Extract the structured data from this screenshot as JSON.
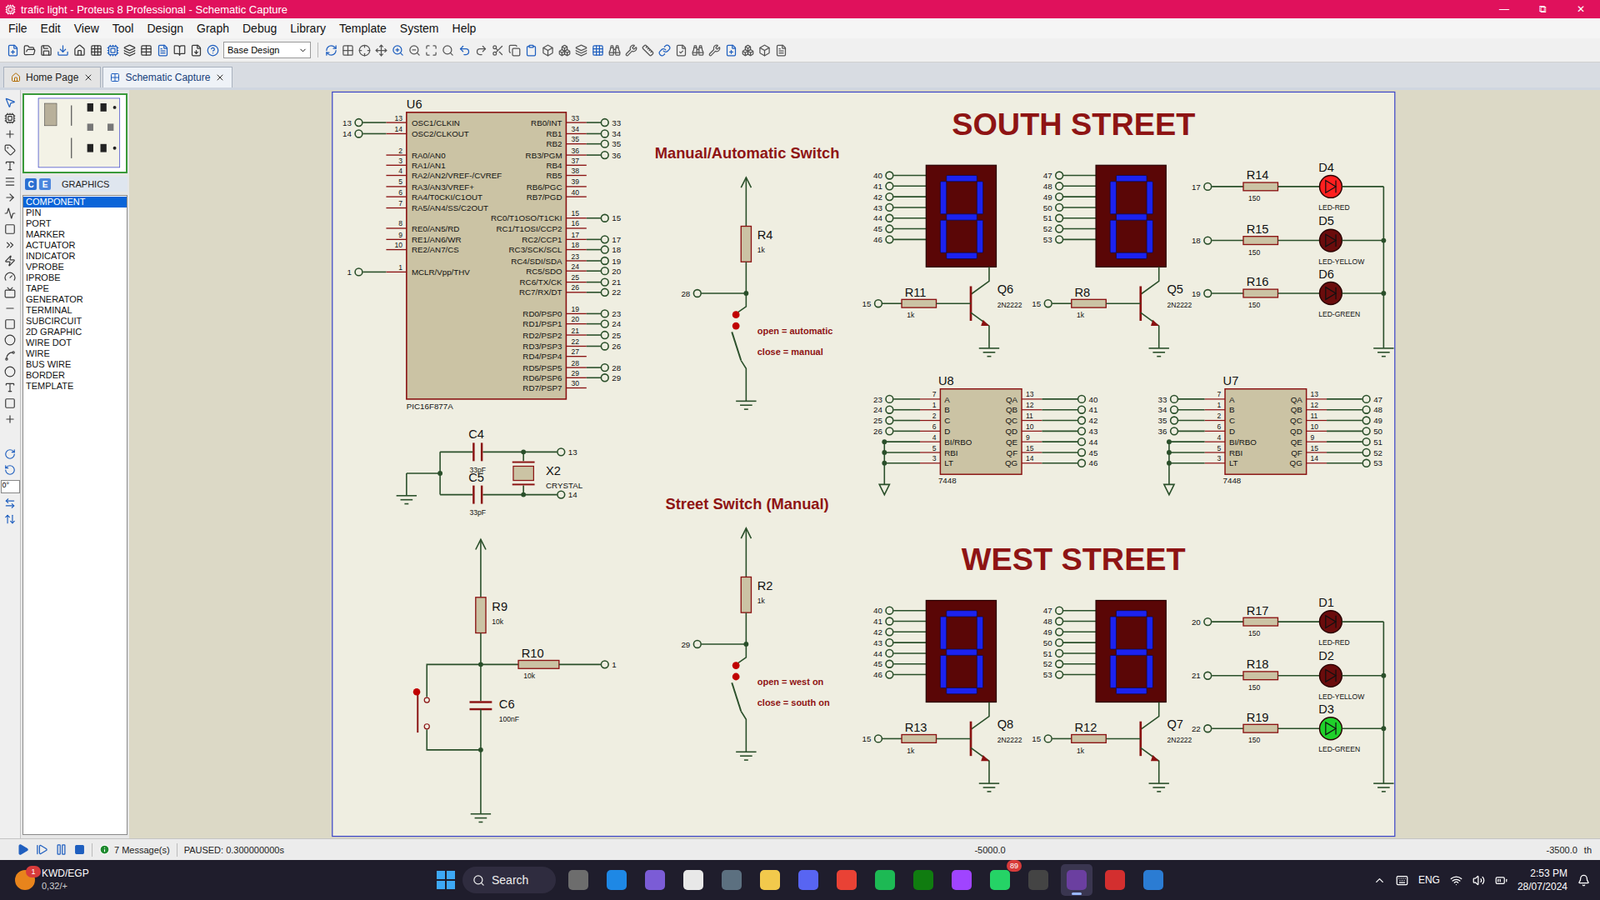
{
  "window": {
    "title": "trafic light - Proteus 8 Professional - Schematic Capture",
    "controls": [
      "—",
      "⧉",
      "✕"
    ]
  },
  "menu": [
    "File",
    "Edit",
    "View",
    "Tool",
    "Design",
    "Graph",
    "Debug",
    "Library",
    "Template",
    "System",
    "Help"
  ],
  "toolbar": {
    "design": "Base Design"
  },
  "tabs": [
    {
      "label": "Home Page",
      "selected": false
    },
    {
      "label": "Schematic Capture",
      "selected": true
    }
  ],
  "side_panel": {
    "mode_buttons": [
      {
        "label": "C",
        "selected": true
      },
      {
        "label": "E",
        "selected": false
      }
    ],
    "title": "GRAPHICS",
    "rotation": "0°",
    "items": [
      {
        "label": "COMPONENT",
        "selected": true
      },
      {
        "label": "PIN",
        "selected": false
      },
      {
        "label": "PORT",
        "selected": false
      },
      {
        "label": "MARKER",
        "selected": false
      },
      {
        "label": "ACTUATOR",
        "selected": false
      },
      {
        "label": "INDICATOR",
        "selected": false
      },
      {
        "label": "VPROBE",
        "selected": false
      },
      {
        "label": "IPROBE",
        "selected": false
      },
      {
        "label": "TAPE",
        "selected": false
      },
      {
        "label": "GENERATOR",
        "selected": false
      },
      {
        "label": "TERMINAL",
        "selected": false
      },
      {
        "label": "SUBCIRCUIT",
        "selected": false
      },
      {
        "label": "2D GRAPHIC",
        "selected": false
      },
      {
        "label": "WIRE DOT",
        "selected": false
      },
      {
        "label": "WIRE",
        "selected": false
      },
      {
        "label": "BUS WIRE",
        "selected": false
      },
      {
        "label": "BORDER",
        "selected": false
      },
      {
        "label": "TEMPLATE",
        "selected": false
      }
    ]
  },
  "schematic": {
    "mcu": {
      "ref": "U6",
      "part": "PIC16F877A",
      "left_pins": [
        {
          "pin": "13",
          "name": "OSC1/CLKIN",
          "net": "13"
        },
        {
          "pin": "14",
          "name": "OSC2/CLKOUT",
          "net": "14"
        },
        {
          "pin": "2",
          "name": "RA0/AN0",
          "net": ""
        },
        {
          "pin": "3",
          "name": "RA1/AN1",
          "net": ""
        },
        {
          "pin": "4",
          "name": "RA2/AN2/VREF-/CVREF",
          "net": ""
        },
        {
          "pin": "5",
          "name": "RA3/AN3/VREF+",
          "net": ""
        },
        {
          "pin": "6",
          "name": "RA4/T0CKI/C1OUT",
          "net": ""
        },
        {
          "pin": "7",
          "name": "RA5/AN4/SS/C2OUT",
          "net": ""
        },
        {
          "pin": "8",
          "name": "RE0/AN5/RD",
          "net": ""
        },
        {
          "pin": "9",
          "name": "RE1/AN6/WR",
          "net": ""
        },
        {
          "pin": "10",
          "name": "RE2/AN7/CS",
          "net": ""
        },
        {
          "pin": "1",
          "name": "MCLR/Vpp/THV",
          "net": "1"
        }
      ],
      "right_pins": [
        {
          "pin": "33",
          "name": "RB0/INT",
          "net": "33"
        },
        {
          "pin": "34",
          "name": "RB1",
          "net": "34"
        },
        {
          "pin": "35",
          "name": "RB2",
          "net": "35"
        },
        {
          "pin": "36",
          "name": "RB3/PGM",
          "net": "36"
        },
        {
          "pin": "37",
          "name": "RB4",
          "net": ""
        },
        {
          "pin": "38",
          "name": "RB5",
          "net": ""
        },
        {
          "pin": "39",
          "name": "RB6/PGC",
          "net": ""
        },
        {
          "pin": "40",
          "name": "RB7/PGD",
          "net": ""
        },
        {
          "pin": "15",
          "name": "RC0/T1OSO/T1CKI",
          "net": "15"
        },
        {
          "pin": "16",
          "name": "RC1/T1OSI/CCP2",
          "net": ""
        },
        {
          "pin": "17",
          "name": "RC2/CCP1",
          "net": "17"
        },
        {
          "pin": "18",
          "name": "RC3/SCK/SCL",
          "net": "18"
        },
        {
          "pin": "23",
          "name": "RC4/SDI/SDA",
          "net": "19"
        },
        {
          "pin": "24",
          "name": "RC5/SDO",
          "net": "20"
        },
        {
          "pin": "25",
          "name": "RC6/TX/CK",
          "net": "21"
        },
        {
          "pin": "26",
          "name": "RC7/RX/DT",
          "net": "22"
        },
        {
          "pin": "19",
          "name": "RD0/PSP0",
          "net": "23"
        },
        {
          "pin": "20",
          "name": "RD1/PSP1",
          "net": "24"
        },
        {
          "pin": "21",
          "name": "RD2/PSP2",
          "net": "25"
        },
        {
          "pin": "22",
          "name": "RD3/PSP3",
          "net": "26"
        },
        {
          "pin": "27",
          "name": "RD4/PSP4",
          "net": ""
        },
        {
          "pin": "28",
          "name": "RD5/PSP5",
          "net": "28"
        },
        {
          "pin": "29",
          "name": "RD6/PSP6",
          "net": "29"
        },
        {
          "pin": "30",
          "name": "RD7/PSP7",
          "net": ""
        }
      ]
    },
    "oscillator": {
      "caps": [
        {
          "ref": "C4",
          "value": "33pF"
        },
        {
          "ref": "C5",
          "value": "33pF"
        }
      ],
      "crystal": {
        "ref": "X2",
        "part": "CRYSTAL"
      },
      "nets": [
        "13",
        "14"
      ]
    },
    "reset": {
      "pullup": {
        "ref": "R9",
        "value": "10k"
      },
      "series": {
        "ref": "R10",
        "value": "10k"
      },
      "cap": {
        "ref": "C6",
        "value": "100nF"
      },
      "net": "1",
      "pressed": false
    },
    "switches": [
      {
        "title": "Manual/Automatic Switch",
        "resistor": {
          "ref": "R4",
          "value": "1k"
        },
        "net": "28",
        "open_label": "open = automatic",
        "close_label": "close = manual",
        "closed": false
      },
      {
        "title": "Street Switch (Manual)",
        "resistor": {
          "ref": "R2",
          "value": "1k"
        },
        "net": "29",
        "open_label": "open = west on",
        "close_label": "close = south on",
        "closed": false
      }
    ],
    "streets": [
      {
        "title": "SOUTH STREET",
        "displays": [
          {
            "pins": [
              "40",
              "41",
              "42",
              "43",
              "44",
              "45",
              "46"
            ],
            "segments": [
              true,
              true,
              true,
              true,
              true,
              true,
              true
            ],
            "transistor": {
              "ref": "Q6",
              "part": "2N2222"
            },
            "resistor": {
              "ref": "R11",
              "value": "1k",
              "net": "15"
            }
          },
          {
            "pins": [
              "47",
              "48",
              "49",
              "50",
              "51",
              "52",
              "53"
            ],
            "segments": [
              true,
              true,
              true,
              true,
              true,
              true,
              true
            ],
            "transistor": {
              "ref": "Q5",
              "part": "2N2222"
            },
            "resistor": {
              "ref": "R8",
              "value": "1k",
              "net": "15"
            }
          }
        ],
        "lights": [
          {
            "resistor": {
              "ref": "R14",
              "value": "150"
            },
            "net": "17",
            "ref": "D4",
            "part": "LED-RED",
            "on": true,
            "color": "#ff1f1f"
          },
          {
            "resistor": {
              "ref": "R15",
              "value": "150"
            },
            "net": "18",
            "ref": "D5",
            "part": "LED-YELLOW",
            "on": false,
            "color": "#ffd21f"
          },
          {
            "resistor": {
              "ref": "R16",
              "value": "150"
            },
            "net": "19",
            "ref": "D6",
            "part": "LED-GREEN",
            "on": false,
            "color": "#1fd12a"
          }
        ]
      },
      {
        "title": "WEST STREET",
        "displays": [
          {
            "pins": [
              "40",
              "41",
              "42",
              "43",
              "44",
              "45",
              "46"
            ],
            "segments": [
              true,
              true,
              true,
              true,
              true,
              true,
              true
            ],
            "transistor": {
              "ref": "Q8",
              "part": "2N2222"
            },
            "resistor": {
              "ref": "R13",
              "value": "1k",
              "net": "15"
            }
          },
          {
            "pins": [
              "47",
              "48",
              "49",
              "50",
              "51",
              "52",
              "53"
            ],
            "segments": [
              true,
              true,
              true,
              true,
              true,
              true,
              true
            ],
            "transistor": {
              "ref": "Q7",
              "part": "2N2222"
            },
            "resistor": {
              "ref": "R12",
              "value": "1k",
              "net": "15"
            }
          }
        ],
        "lights": [
          {
            "resistor": {
              "ref": "R17",
              "value": "150"
            },
            "net": "20",
            "ref": "D1",
            "part": "LED-RED",
            "on": false,
            "color": "#ff1f1f"
          },
          {
            "resistor": {
              "ref": "R18",
              "value": "150"
            },
            "net": "21",
            "ref": "D2",
            "part": "LED-YELLOW",
            "on": false,
            "color": "#ffd21f"
          },
          {
            "resistor": {
              "ref": "R19",
              "value": "150"
            },
            "net": "22",
            "ref": "D3",
            "part": "LED-GREEN",
            "on": true,
            "color": "#1fd12a"
          }
        ]
      }
    ],
    "decoders": [
      {
        "ref": "U8",
        "part": "7448",
        "inputs": [
          {
            "pin": "7",
            "name": "A",
            "net": "23"
          },
          {
            "pin": "1",
            "name": "B",
            "net": "24"
          },
          {
            "pin": "2",
            "name": "C",
            "net": "25"
          },
          {
            "pin": "6",
            "name": "D",
            "net": "26"
          },
          {
            "pin": "4",
            "name": "BI/RBO",
            "net": ""
          },
          {
            "pin": "5",
            "name": "RBI",
            "net": ""
          },
          {
            "pin": "3",
            "name": "LT",
            "net": ""
          }
        ],
        "outputs": [
          {
            "pin": "13",
            "name": "QA",
            "net": "40"
          },
          {
            "pin": "12",
            "name": "QB",
            "net": "41"
          },
          {
            "pin": "11",
            "name": "QC",
            "net": "42"
          },
          {
            "pin": "10",
            "name": "QD",
            "net": "43"
          },
          {
            "pin": "9",
            "name": "QE",
            "net": "44"
          },
          {
            "pin": "15",
            "name": "QF",
            "net": "45"
          },
          {
            "pin": "14",
            "name": "QG",
            "net": "46"
          }
        ]
      },
      {
        "ref": "U7",
        "part": "7448",
        "inputs": [
          {
            "pin": "7",
            "name": "A",
            "net": "33"
          },
          {
            "pin": "1",
            "name": "B",
            "net": "34"
          },
          {
            "pin": "2",
            "name": "C",
            "net": "35"
          },
          {
            "pin": "6",
            "name": "D",
            "net": "36"
          },
          {
            "pin": "4",
            "name": "BI/RBO",
            "net": ""
          },
          {
            "pin": "5",
            "name": "RBI",
            "net": ""
          },
          {
            "pin": "3",
            "name": "LT",
            "net": ""
          }
        ],
        "outputs": [
          {
            "pin": "13",
            "name": "QA",
            "net": "47"
          },
          {
            "pin": "12",
            "name": "QB",
            "net": "48"
          },
          {
            "pin": "11",
            "name": "QC",
            "net": "49"
          },
          {
            "pin": "10",
            "name": "QD",
            "net": "50"
          },
          {
            "pin": "9",
            "name": "QE",
            "net": "51"
          },
          {
            "pin": "15",
            "name": "QF",
            "net": "52"
          },
          {
            "pin": "14",
            "name": "QG",
            "net": "53"
          }
        ]
      }
    ]
  },
  "status_bar": {
    "messages": "7 Message(s)",
    "state": "PAUSED: 0.300000000s",
    "x": "-5000.0",
    "y": "-3500.0",
    "units": "th"
  },
  "taskbar": {
    "ticker": {
      "badge": "1",
      "title": "KWD/EGP",
      "value": "0,32/+"
    },
    "search": "Search",
    "apps": [
      {
        "badge": "",
        "active": false
      },
      {
        "badge": "",
        "active": false
      },
      {
        "badge": "",
        "active": false
      },
      {
        "badge": "",
        "active": false
      },
      {
        "badge": "",
        "active": false
      },
      {
        "badge": "",
        "active": false
      },
      {
        "badge": "",
        "active": false
      },
      {
        "badge": "",
        "active": false
      },
      {
        "badge": "",
        "active": false
      },
      {
        "badge": "",
        "active": false
      },
      {
        "badge": "",
        "active": false
      },
      {
        "badge": "89",
        "active": false
      },
      {
        "badge": "",
        "active": false
      },
      {
        "badge": "",
        "active": true
      },
      {
        "badge": "",
        "active": false
      },
      {
        "badge": "",
        "active": false
      }
    ],
    "language": "ENG",
    "time": "2:53 PM",
    "date": "28/07/2024"
  }
}
